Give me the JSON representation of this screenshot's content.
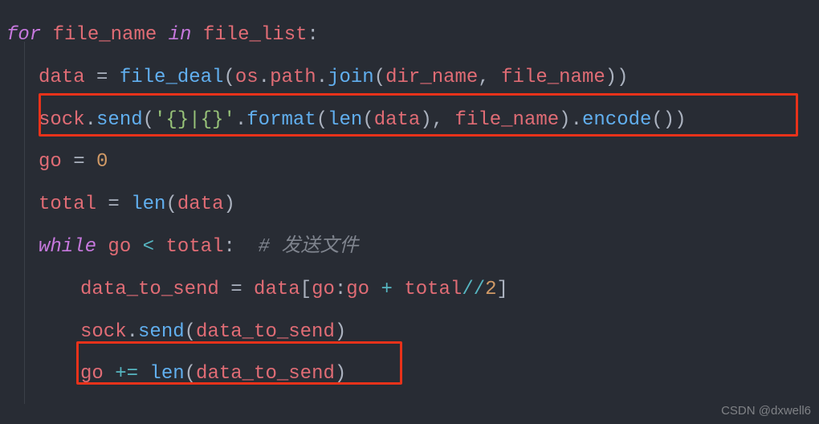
{
  "code": {
    "l1": {
      "for": "for",
      "file_name": "file_name",
      "in": "in",
      "file_list": "file_list",
      "colon": ":"
    },
    "l2": {
      "data": "data",
      "eq": " = ",
      "file_deal": "file_deal",
      "po": "(",
      "os": "os",
      "dot1": ".",
      "path": "path",
      "dot2": ".",
      "join": "join",
      "po2": "(",
      "dir_name": "dir_name",
      "comma": ", ",
      "file_name": "file_name",
      "pc": "))"
    },
    "l3": {
      "sock": "sock",
      "dot1": ".",
      "send": "send",
      "po": "(",
      "str": "'{}|{}'",
      "dot2": ".",
      "format": "format",
      "po2": "(",
      "len": "len",
      "po3": "(",
      "data": "data",
      "pc1": "), ",
      "file_name": "file_name",
      "pc2": ").",
      "encode": "encode",
      "pc3": "())"
    },
    "l4": {
      "go": "go",
      "eq": " = ",
      "zero": "0"
    },
    "l5": {
      "total": "total",
      "eq": " = ",
      "len": "len",
      "po": "(",
      "data": "data",
      "pc": ")"
    },
    "l6": {
      "while": "while",
      "go": "go",
      "lt": " < ",
      "total": "total",
      "colon": ":",
      "comment": "  # 发送文件"
    },
    "l7": {
      "dts": "data_to_send",
      "eq": " = ",
      "data": "data",
      "br1": "[",
      "go1": "go",
      "colon": ":",
      "go2": "go",
      "plus": " + ",
      "total": "total",
      "div": "//",
      "two": "2",
      "br2": "]"
    },
    "l8": {
      "sock": "sock",
      "dot": ".",
      "send": "send",
      "po": "(",
      "dts": "data_to_send",
      "pc": ")"
    },
    "l9": {
      "go": "go",
      "pe": " += ",
      "len": "len",
      "po": "(",
      "dts": "data_to_send",
      "pc": ")"
    }
  },
  "watermark": "CSDN @dxwell6"
}
